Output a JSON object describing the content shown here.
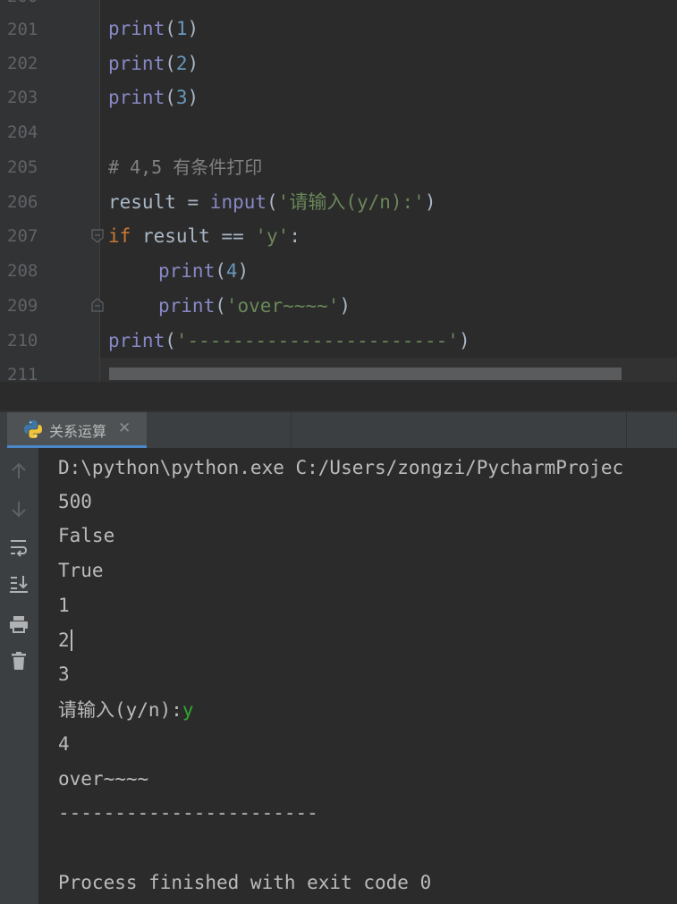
{
  "editor": {
    "line_numbers": [
      "201",
      "202",
      "203",
      "204",
      "205",
      "206",
      "207",
      "208",
      "209",
      "210",
      "211"
    ],
    "lines": {
      "l201": {
        "fn": "print",
        "open": "(",
        "arg": "1",
        "close": ")"
      },
      "l202": {
        "fn": "print",
        "open": "(",
        "arg": "2",
        "close": ")"
      },
      "l203": {
        "fn": "print",
        "open": "(",
        "arg": "3",
        "close": ")"
      },
      "l205": {
        "comment": "# 4,5 有条件打印"
      },
      "l206": {
        "var": "result = ",
        "fn": "input",
        "open": "(",
        "str": "'请输入(y/n):'",
        "close": ")"
      },
      "l207": {
        "kw": "if",
        "mid": " result == ",
        "str": "'y'",
        "colon": ":"
      },
      "l208": {
        "fn": "print",
        "open": "(",
        "arg": "4",
        "close": ")"
      },
      "l209": {
        "fn": "print",
        "open": "(",
        "str": "'over~~~~'",
        "close": ")"
      },
      "l210": {
        "fn": "print",
        "open": "(",
        "str": "'-----------------------'",
        "close": ")"
      }
    }
  },
  "run_panel": {
    "tab_label": "关系运算",
    "tab_close": "✕"
  },
  "console": {
    "lines": [
      "D:\\python\\python.exe C:/Users/zongzi/PycharmProjec",
      "500",
      "False",
      "True",
      "1",
      "2",
      "3",
      "请输入(y/n):",
      "4",
      "over~~~~",
      "-----------------------",
      "",
      "Process finished with exit code 0"
    ],
    "user_input": "y"
  },
  "sidebar_icons": [
    "arrow-up-icon",
    "arrow-down-icon",
    "soft-wrap-icon",
    "scroll-to-end-icon",
    "print-icon",
    "trash-icon"
  ],
  "colors": {
    "background": "#2b2b2b",
    "function": "#8888c6",
    "number": "#6897bb",
    "string": "#6a8759",
    "keyword": "#cc7832",
    "comment": "#808080",
    "input_echo": "#2fa82f",
    "tab_accent": "#4a88c7"
  }
}
